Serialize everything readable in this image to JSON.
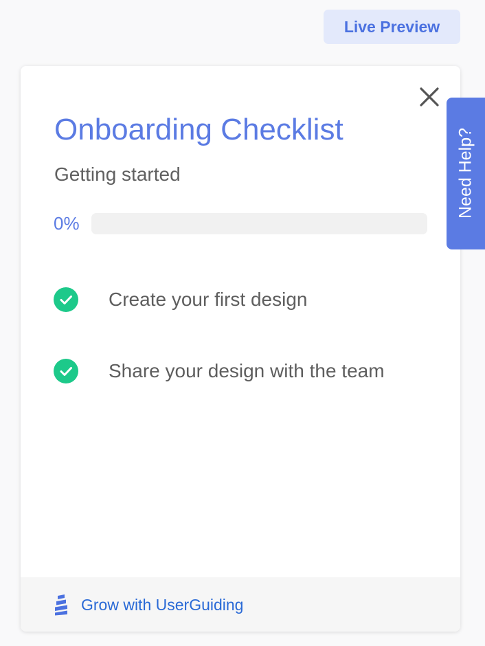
{
  "header": {
    "live_preview_label": "Live Preview"
  },
  "checklist": {
    "title": "Onboarding Checklist",
    "subtitle": "Getting started",
    "progress": {
      "text": "0%",
      "value_percent": 0
    },
    "items": [
      {
        "label": "Create your first design",
        "completed": true,
        "icon": "check-circle-icon"
      },
      {
        "label": "Share your design with the team",
        "completed": true,
        "icon": "check-circle-icon"
      }
    ],
    "close_icon": "close-icon",
    "footer": {
      "link_label": "Grow with UserGuiding",
      "logo_icon": "userguiding-logo-icon"
    }
  },
  "help_tab": {
    "label": "Need Help?"
  },
  "colors": {
    "accent": "#5b7be3",
    "live_preview_bg": "#e3e9fb",
    "check_green": "#1dc98a",
    "footer_link": "#2a6ad6",
    "text_gray": "#606060",
    "progress_track": "#f1f1f1"
  }
}
